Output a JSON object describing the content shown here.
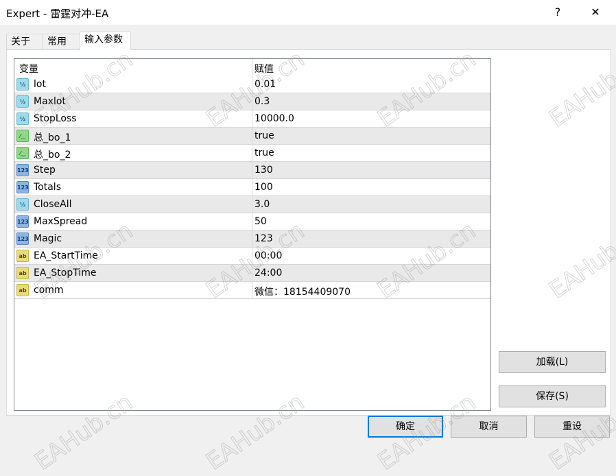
{
  "window": {
    "title": "Expert - 雷霆对冲-EA",
    "help": "?",
    "close": "✕"
  },
  "tabs": [
    {
      "label": "关于"
    },
    {
      "label": "常用"
    },
    {
      "label": "输入参数"
    }
  ],
  "table": {
    "headers": [
      "变量",
      "赋值"
    ],
    "rows": [
      {
        "icon": "half",
        "name": "lot",
        "value": "0.01"
      },
      {
        "icon": "half",
        "name": "Maxlot",
        "value": "0.3"
      },
      {
        "icon": "half",
        "name": "StopLoss",
        "value": "10000.0"
      },
      {
        "icon": "bool",
        "name": "总_bo_1",
        "value": "true"
      },
      {
        "icon": "bool",
        "name": "总_bo_2",
        "value": "true"
      },
      {
        "icon": "int",
        "name": "Step",
        "value": "130"
      },
      {
        "icon": "int",
        "name": "Totals",
        "value": "100"
      },
      {
        "icon": "half",
        "name": "CloseAll",
        "value": "3.0"
      },
      {
        "icon": "int",
        "name": "MaxSpread",
        "value": "50"
      },
      {
        "icon": "int",
        "name": "Magic",
        "value": "123"
      },
      {
        "icon": "str",
        "name": "EA_StartTime",
        "value": "00:00"
      },
      {
        "icon": "str",
        "name": "EA_StopTime",
        "value": "24:00"
      },
      {
        "icon": "str",
        "name": "comm",
        "value": "微信：18154409070"
      }
    ]
  },
  "icon_glyphs": {
    "half": "½",
    "int": "123",
    "bool": "⁄‿",
    "str": "ab"
  },
  "buttons": {
    "load": "加载(L)",
    "save": "保存(S)",
    "ok": "确定",
    "cancel": "取消",
    "reset": "重设"
  },
  "watermark": "EAHub.cn"
}
